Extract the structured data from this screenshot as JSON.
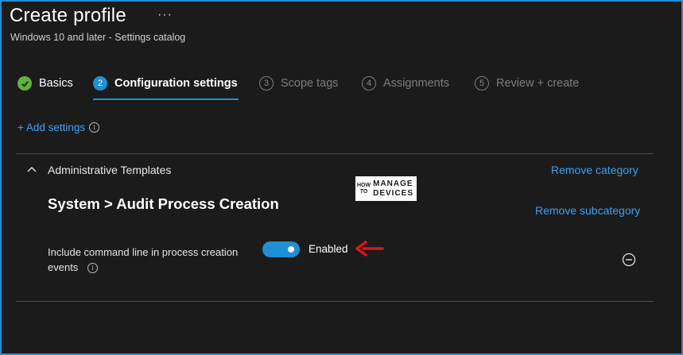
{
  "header": {
    "title": "Create profile",
    "more_glyph": "···",
    "subtitle": "Windows 10 and later - Settings catalog"
  },
  "wizard": {
    "steps": [
      {
        "number": "✓",
        "label": "Basics",
        "state": "done"
      },
      {
        "number": "2",
        "label": "Configuration settings",
        "state": "active"
      },
      {
        "number": "3",
        "label": "Scope tags",
        "state": "inactive"
      },
      {
        "number": "4",
        "label": "Assignments",
        "state": "inactive"
      },
      {
        "number": "5",
        "label": "Review + create",
        "state": "inactive"
      }
    ]
  },
  "add_settings": {
    "label": "+ Add settings",
    "info_glyph": "i"
  },
  "category": {
    "title": "Administrative Templates",
    "remove_label": "Remove category",
    "subcategory_title": "System > Audit Process Creation",
    "remove_subcategory_label": "Remove subcategory"
  },
  "logo": {
    "how": "HOW\nTO",
    "rest": "MANAGE\nDEVICES"
  },
  "setting": {
    "label": "Include command line in process creation events",
    "info_glyph": "i",
    "toggle_on": true,
    "toggle_state": "Enabled"
  },
  "colors": {
    "accent": "#1f8fd6",
    "link": "#3aa0f3",
    "success": "#5db53e",
    "annotation_arrow": "#e0131b",
    "background": "#1b1b1b"
  }
}
